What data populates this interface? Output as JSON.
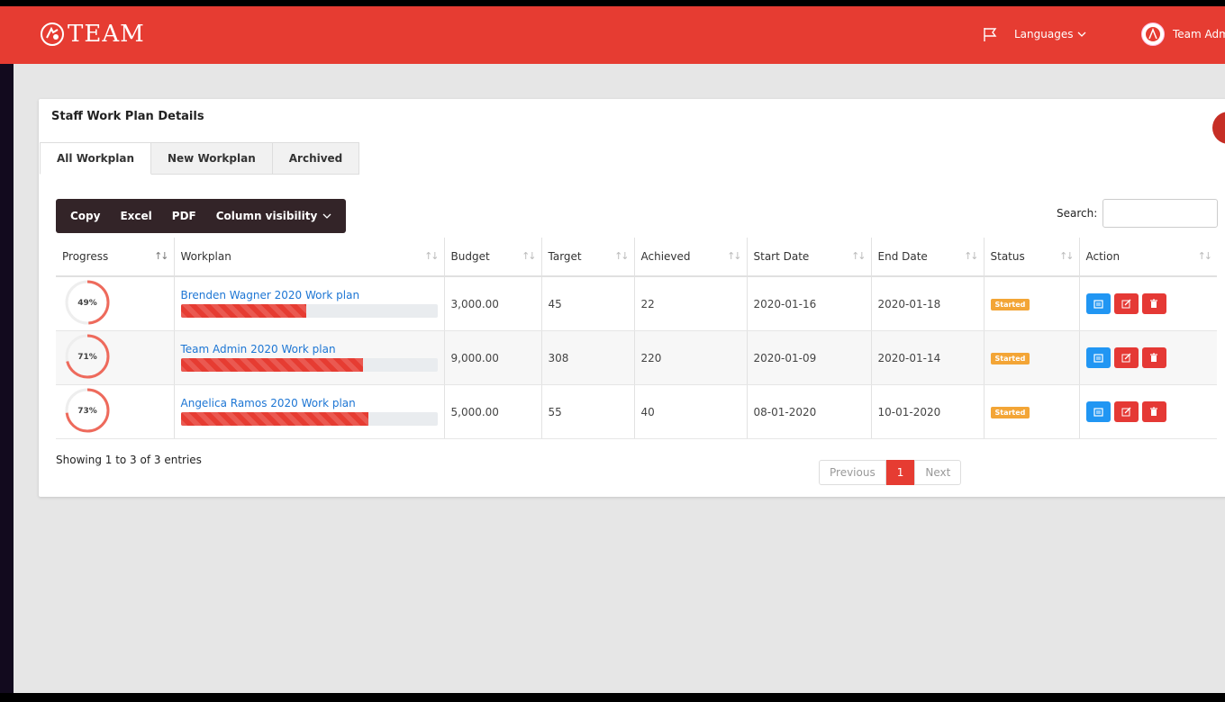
{
  "header": {
    "logo_text": "TEAM",
    "languages_label": "Languages",
    "user_name": "Team Admin"
  },
  "card": {
    "title": "Staff Work Plan Details"
  },
  "tabs": [
    {
      "label": "All Workplan",
      "active": true
    },
    {
      "label": "New Workplan",
      "active": false
    },
    {
      "label": "Archived",
      "active": false
    }
  ],
  "toolbar": {
    "copy": "Copy",
    "excel": "Excel",
    "pdf": "PDF",
    "column_visibility": "Column visibility"
  },
  "search": {
    "label": "Search:",
    "value": ""
  },
  "table": {
    "columns": [
      "Progress",
      "Workplan",
      "Budget",
      "Target",
      "Achieved",
      "Start Date",
      "End Date",
      "Status",
      "Action"
    ],
    "rows": [
      {
        "progress": 49,
        "progress_label": "49%",
        "workplan": "Brenden Wagner 2020 Work plan",
        "budget": "3,000.00",
        "target": "45",
        "achieved": "22",
        "start": "2020-01-16",
        "end": "2020-01-18",
        "status": "Started"
      },
      {
        "progress": 71,
        "progress_label": "71%",
        "workplan": "Team Admin 2020 Work plan",
        "budget": "9,000.00",
        "target": "308",
        "achieved": "220",
        "start": "2020-01-09",
        "end": "2020-01-14",
        "status": "Started"
      },
      {
        "progress": 73,
        "progress_label": "73%",
        "workplan": "Angelica Ramos 2020 Work plan",
        "budget": "5,000.00",
        "target": "55",
        "achieved": "40",
        "start": "08-01-2020",
        "end": "10-01-2020",
        "status": "Started"
      }
    ]
  },
  "footer": {
    "info": "Showing 1 to 3 of 3 entries",
    "previous": "Previous",
    "current_page": "1",
    "next": "Next"
  },
  "colors": {
    "brand": "#e63c32",
    "link": "#1d76d4",
    "status": "#f3a536"
  }
}
